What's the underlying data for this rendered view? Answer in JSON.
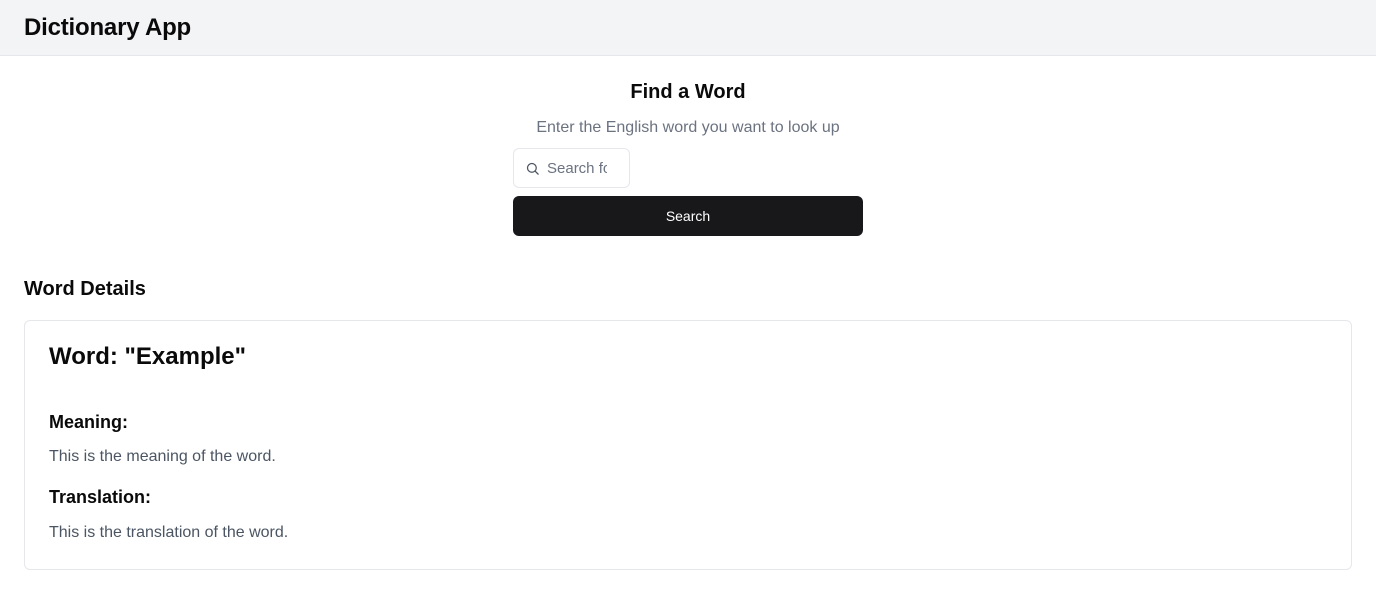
{
  "app": {
    "title": "Dictionary App"
  },
  "search": {
    "title": "Find a Word",
    "subtitle": "Enter the English word you want to look up",
    "input_value": "",
    "placeholder": "Search for a word...",
    "icon": "search-icon",
    "button_label": "Search"
  },
  "details": {
    "heading": "Word Details",
    "word_title": "Word: \"Example\"",
    "meaning_label": "Meaning:",
    "meaning_text": "This is the meaning of the word.",
    "translation_label": "Translation:",
    "translation_text": "This is the translation of the word."
  },
  "colors": {
    "header_bg": "#f3f4f6",
    "button_bg": "#18181b",
    "button_text": "#ffffff",
    "muted_text": "#6b7280",
    "border": "#e5e7eb"
  }
}
